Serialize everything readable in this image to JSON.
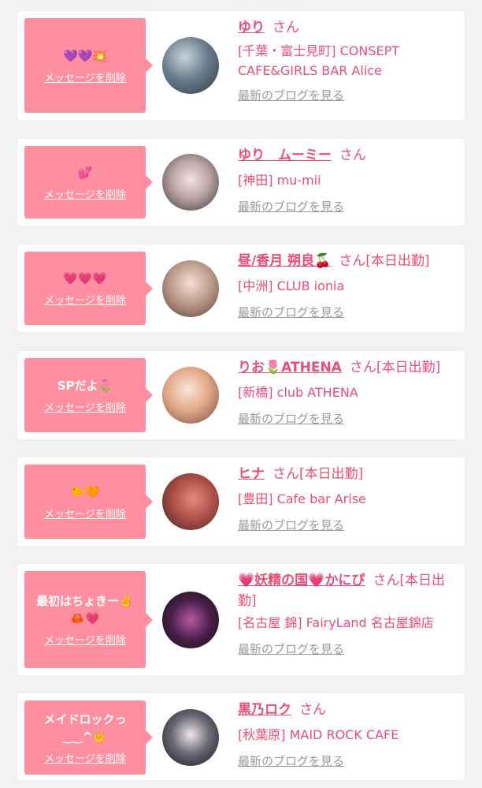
{
  "delete_label": "メッセージを削除",
  "blog_label": "最新のブログを見る",
  "cards": [
    {
      "message": "💜💜💥",
      "name": "ゆり",
      "honorific": "さん",
      "status": "",
      "shop": "[千葉・富士見町] CONSEPT CAFE&GIRLS BAR Alice"
    },
    {
      "message": "💕",
      "name": "ゆり　ムーミー",
      "honorific": "さん",
      "status": "",
      "shop": "[神田] mu-mii"
    },
    {
      "message": "💗💗💗",
      "name": "昼/香月 朔良🍒",
      "honorific": "さん",
      "status": "[本日出勤]",
      "shop": "[中洲] CLUB ionia"
    },
    {
      "message": "SPだよ🌷",
      "name": "りお🌷ATHENA",
      "honorific": "さん",
      "status": "[本日出勤]",
      "shop": "[新橋] club ATHENA"
    },
    {
      "message": "🐤🧡",
      "name": "ヒナ",
      "honorific": "さん",
      "status": "[本日出勤]",
      "shop": "[豊田] Cafe bar Arise"
    },
    {
      "message": "最初はちょきー✌️🦀💗",
      "name": "💗妖精の国💗かにぴ",
      "honorific": "さん",
      "status": "[本日出勤]",
      "shop": "[名古屋 錦] FairyLand 名古屋錦店"
    },
    {
      "message": "メイドロックっ‿‿^🤟",
      "name": "黒乃ロク",
      "honorific": "さん",
      "status": "",
      "shop": "[秋葉原] MAID ROCK CAFE"
    }
  ]
}
